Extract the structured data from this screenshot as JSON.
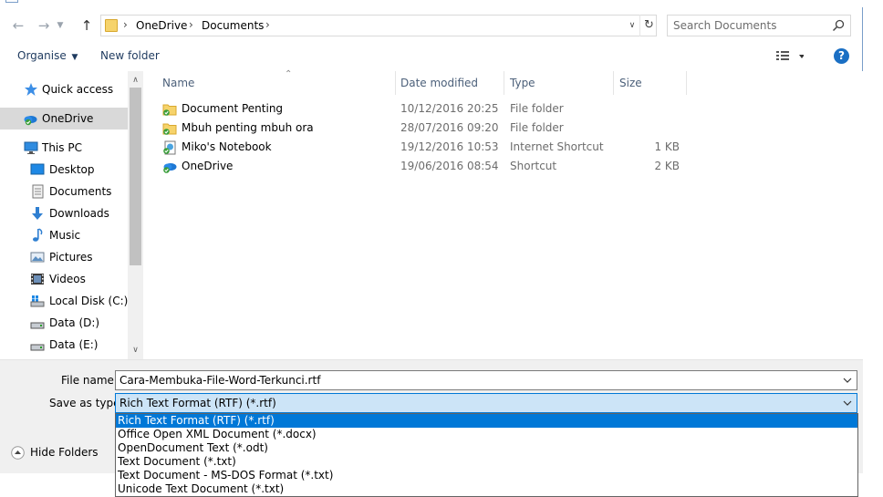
{
  "address": {
    "crumbs": [
      "OneDrive",
      "Documents"
    ]
  },
  "search": {
    "placeholder": "Search Documents"
  },
  "toolbar": {
    "organise_label": "Organise",
    "new_folder_label": "New folder",
    "help_label": "?"
  },
  "nav": {
    "items": [
      {
        "label": "Quick access",
        "icon": "star-icon"
      },
      {
        "label": "OneDrive",
        "icon": "onedrive-icon",
        "selected": true
      },
      {
        "label": "This PC",
        "icon": "computer-icon"
      },
      {
        "label": "Desktop",
        "icon": "desktop-icon"
      },
      {
        "label": "Documents",
        "icon": "documents-icon"
      },
      {
        "label": "Downloads",
        "icon": "download-icon"
      },
      {
        "label": "Music",
        "icon": "music-icon"
      },
      {
        "label": "Pictures",
        "icon": "pictures-icon"
      },
      {
        "label": "Videos",
        "icon": "videos-icon"
      },
      {
        "label": "Local Disk (C:)",
        "icon": "drive-icon"
      },
      {
        "label": "Data (D:)",
        "icon": "drive-icon"
      },
      {
        "label": "Data (E:)",
        "icon": "drive-icon"
      }
    ]
  },
  "columns": {
    "name": "Name",
    "date": "Date modified",
    "type": "Type",
    "size": "Size"
  },
  "files": [
    {
      "name": "Document Penting",
      "date": "10/12/2016 20:25",
      "type": "File folder",
      "size": "",
      "icon": "synced-folder-icon"
    },
    {
      "name": "Mbuh penting mbuh ora",
      "date": "28/07/2016 09:20",
      "type": "File folder",
      "size": "",
      "icon": "synced-folder-icon"
    },
    {
      "name": "Miko's Notebook",
      "date": "19/12/2016 10:53",
      "type": "Internet Shortcut",
      "size": "1 KB",
      "icon": "internet-shortcut-icon"
    },
    {
      "name": "OneDrive",
      "date": "19/06/2016 08:54",
      "type": "Shortcut",
      "size": "2 KB",
      "icon": "onedrive-shortcut-icon"
    }
  ],
  "form": {
    "filename_label": "File name:",
    "filename_value": "Cara-Membuka-File-Word-Terkunci.rtf",
    "savetype_label": "Save as type:",
    "savetype_value": "Rich Text Format (RTF) (*.rtf)",
    "hide_folders_label": "Hide Folders"
  },
  "savetype_options": [
    "Rich Text Format (RTF) (*.rtf)",
    "Office Open XML Document (*.docx)",
    "OpenDocument Text (*.odt)",
    "Text Document (*.txt)",
    "Text Document - MS-DOS Format (*.txt)",
    "Unicode Text Document (*.txt)"
  ],
  "colors": {
    "accent": "#0078d7",
    "selection_bg": "#cce4f7",
    "nav_selected": "#d9d9d9"
  }
}
